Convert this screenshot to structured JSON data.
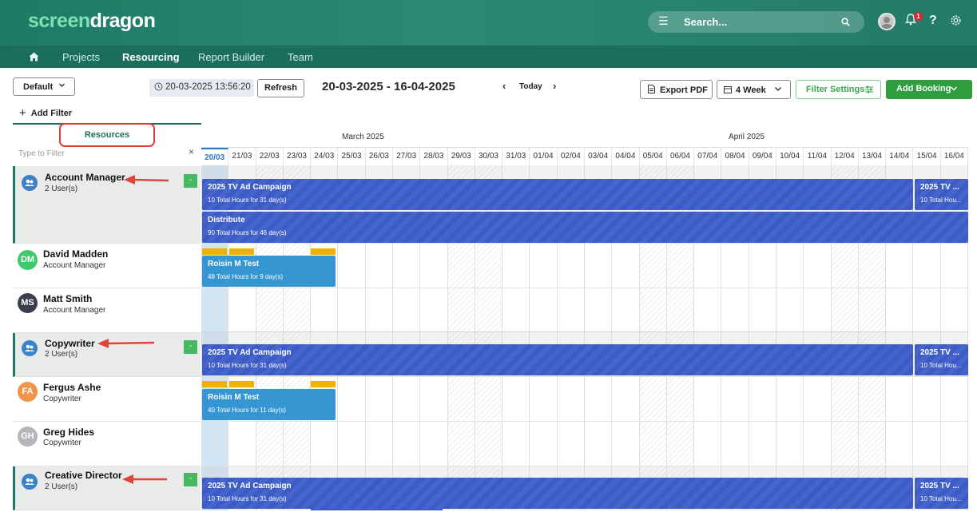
{
  "app": {
    "logo_part1": "screen",
    "logo_part2": "dragon",
    "search_placeholder": "Search...",
    "notification_count": "1",
    "help_label": "?"
  },
  "nav": {
    "items": [
      "Projects",
      "Resourcing",
      "Report Builder",
      "Team"
    ],
    "active": "Resourcing"
  },
  "toolbar": {
    "view_select": "Default",
    "datetime": "20-03-2025 13:56:20",
    "refresh": "Refresh",
    "range": "20-03-2025 - 16-04-2025",
    "today": "Today",
    "export_pdf": "Export PDF",
    "period_select": "4 Week",
    "filter_settings": "Filter Settings",
    "add_booking": "Add Booking",
    "add_filter": "Add Filter"
  },
  "left_panel": {
    "tab": "Resources",
    "filter_placeholder": "Type to Filter",
    "clear": "×",
    "collapse_label": "-"
  },
  "timeline": {
    "months": [
      "March 2025",
      "April 2025"
    ],
    "dates": [
      "20/03",
      "21/03",
      "22/03",
      "23/03",
      "24/03",
      "25/03",
      "26/03",
      "27/03",
      "28/03",
      "29/03",
      "30/03",
      "31/03",
      "01/04",
      "02/04",
      "03/04",
      "04/04",
      "05/04",
      "06/04",
      "07/04",
      "08/04",
      "09/04",
      "10/04",
      "11/04",
      "12/04",
      "13/04",
      "14/04",
      "15/04",
      "16/04"
    ],
    "weekend_indices": [
      2,
      3,
      9,
      10,
      16,
      17,
      23,
      24
    ],
    "today_index": 0
  },
  "rows": [
    {
      "type": "group",
      "name": "Account Manager",
      "sub": "2 User(s)"
    },
    {
      "type": "person",
      "initials": "DM",
      "name": "David Madden",
      "sub": "Account Manager",
      "color": "#3fc96f"
    },
    {
      "type": "person",
      "initials": "MS",
      "name": "Matt Smith",
      "sub": "Account Manager",
      "color": "#3a3f4b"
    },
    {
      "type": "group",
      "name": "Copywriter",
      "sub": "2 User(s)"
    },
    {
      "type": "person",
      "initials": "FA",
      "name": "Fergus Ashe",
      "sub": "Copywriter",
      "color": "#f0944a"
    },
    {
      "type": "person",
      "initials": "GH",
      "name": "Greg Hides",
      "sub": "Copywriter",
      "color": "#b5b8bb"
    },
    {
      "type": "group",
      "name": "Creative Director",
      "sub": "2 User(s)"
    }
  ],
  "bookings": {
    "am_campaign": {
      "title": "2025 TV Ad Campaign",
      "sub": "10 Total Hours for 31 day(s)"
    },
    "am_campaign_cont": {
      "title": "2025 TV ...",
      "sub": "10 Total Hou..."
    },
    "am_distribute": {
      "title": "Distribute",
      "sub": "90 Total Hours for 46 day(s)"
    },
    "dm_roisin": {
      "title": "Roisin M Test",
      "sub": "48 Total Hours for 9 day(s)"
    },
    "cw_campaign": {
      "title": "2025 TV Ad Campaign",
      "sub": "10 Total Hours for 31 day(s)"
    },
    "cw_campaign_cont": {
      "title": "2025 TV ...",
      "sub": "10 Total Hou..."
    },
    "fa_roisin": {
      "title": "Roisin M Test",
      "sub": "40 Total Hours for 11 day(s)"
    },
    "cd_campaign": {
      "title": "2025 TV Ad Campaign",
      "sub": "10 Total Hours for 31 day(s)"
    },
    "cd_campaign_cont": {
      "title": "2025 TV ...",
      "sub": "10 Total Hou..."
    }
  },
  "colors": {
    "header": "#237a68",
    "nav": "#1c6e5c",
    "booking_dark": "#3c5bc6",
    "booking_light": "#3696d2",
    "overbooked": "#f2b000",
    "annotation_arrow": "#e0433a"
  }
}
